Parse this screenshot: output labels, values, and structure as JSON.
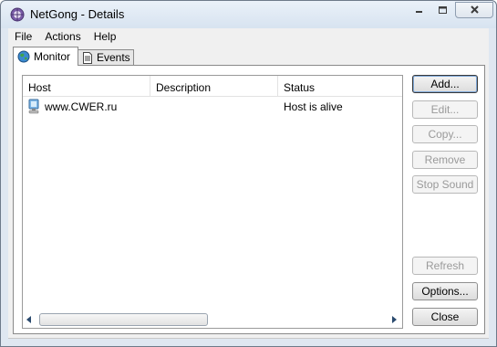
{
  "window": {
    "title": "NetGong - Details"
  },
  "menu": {
    "items": [
      "File",
      "Actions",
      "Help"
    ]
  },
  "tabs": [
    {
      "label": "Monitor",
      "icon": "globe-icon",
      "active": true
    },
    {
      "label": "Events",
      "icon": "document-icon",
      "active": false
    }
  ],
  "list": {
    "columns": [
      "Host",
      "Description",
      "Status"
    ],
    "rows": [
      {
        "host": "www.CWER.ru",
        "description": "",
        "status": "Host is alive",
        "icon": "computer-icon"
      }
    ]
  },
  "buttons": {
    "add": "Add...",
    "edit": "Edit...",
    "copy": "Copy...",
    "remove": "Remove",
    "stop_sound": "Stop Sound",
    "refresh": "Refresh",
    "options": "Options...",
    "close": "Close"
  },
  "colors": {
    "title_bar": "#d7e3f0",
    "panel_background": "#f0f0f0",
    "disabled_text": "#9a9a9a"
  }
}
